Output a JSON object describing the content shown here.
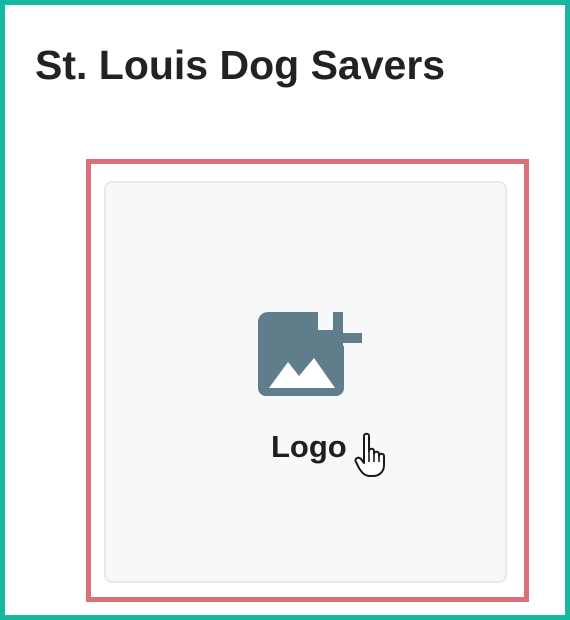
{
  "header": {
    "title": "St. Louis Dog Savers"
  },
  "upload": {
    "label": "Logo",
    "icon": "image-add-icon"
  },
  "cursor": {
    "icon": "hand-pointer-icon"
  },
  "colors": {
    "frame_border": "#14b8a0",
    "highlight_border": "#d9707a",
    "tile_background": "#f7f8f8",
    "tile_border": "#e7e9ea",
    "icon_fill": "#607d8b",
    "title_text": "#222222"
  }
}
